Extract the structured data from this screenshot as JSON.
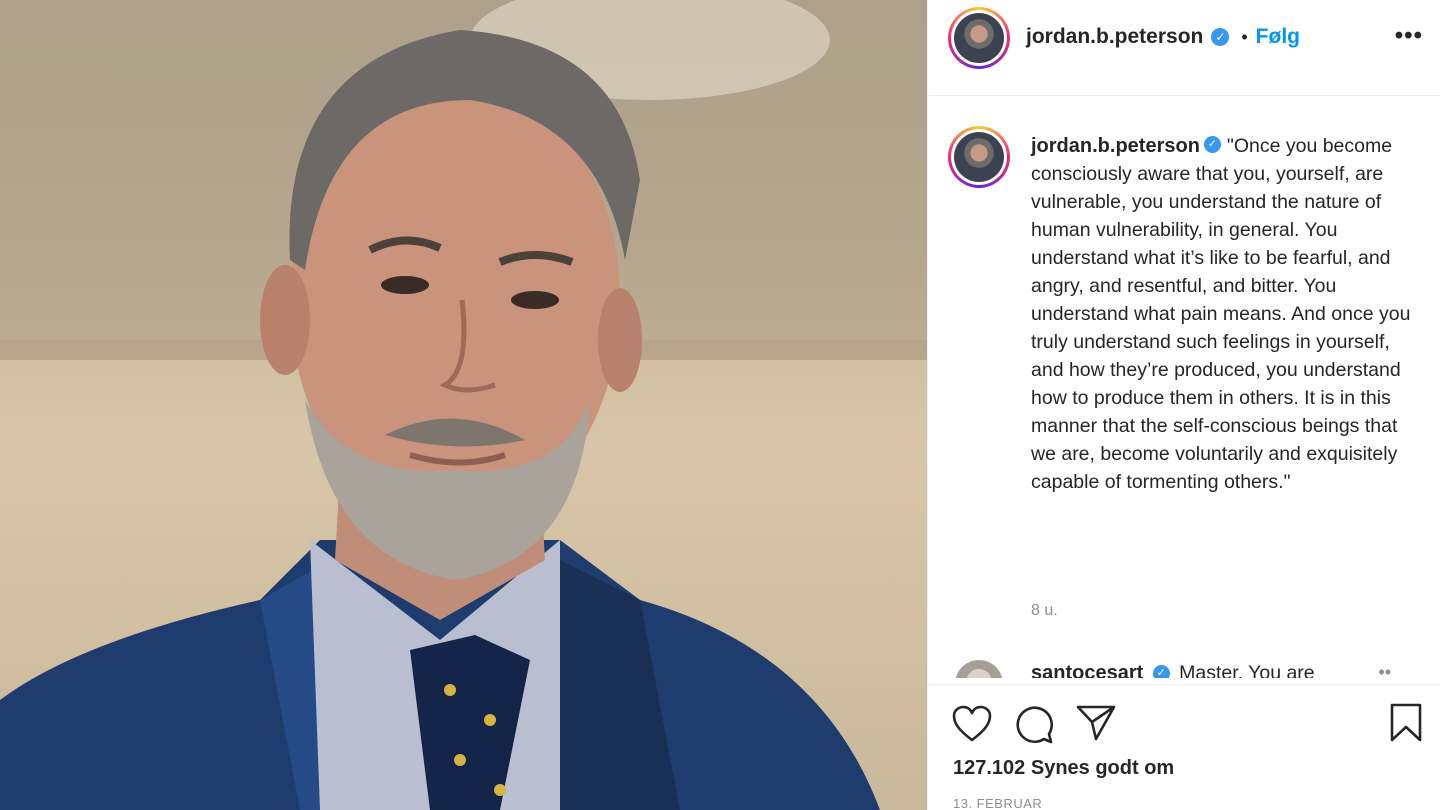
{
  "post": {
    "image_alt": "Portrait photo",
    "author": {
      "username": "jordan.b.peterson",
      "verified": true,
      "verified_icon": "verified-badge-icon"
    },
    "header": {
      "separator": "•",
      "follow_label": "Følg",
      "more_icon": "more-options-icon",
      "more_label": "•••"
    },
    "caption": {
      "text": "\"Once you become consciously aware that you, yourself, are vulnerable, you understand the nature of human vulnerability, in general. You understand what it’s like to be fearful, and angry, and resentful, and bitter. You understand what pain means. And once you truly understand such feelings in yourself, and how they’re produced, you understand how to produce them in others. It is in this manner that the self-conscious beings that we are, become voluntarily and exquisitely capable of tormenting others.\"",
      "age": "8 u."
    },
    "comment": {
      "username": "santocesart",
      "text": "Master, You are",
      "more_label": "••"
    },
    "actions": {
      "like_icon": "heart-icon",
      "comment_icon": "comment-icon",
      "share_icon": "paper-plane-icon",
      "save_icon": "bookmark-icon"
    },
    "likes_text": "127.102 Synes godt om",
    "date_text": "13. FEBRUAR"
  },
  "colors": {
    "accent_blue": "#0095f6",
    "verified_blue": "#3897f0",
    "text": "#262626",
    "muted": "#8e8e8e"
  }
}
